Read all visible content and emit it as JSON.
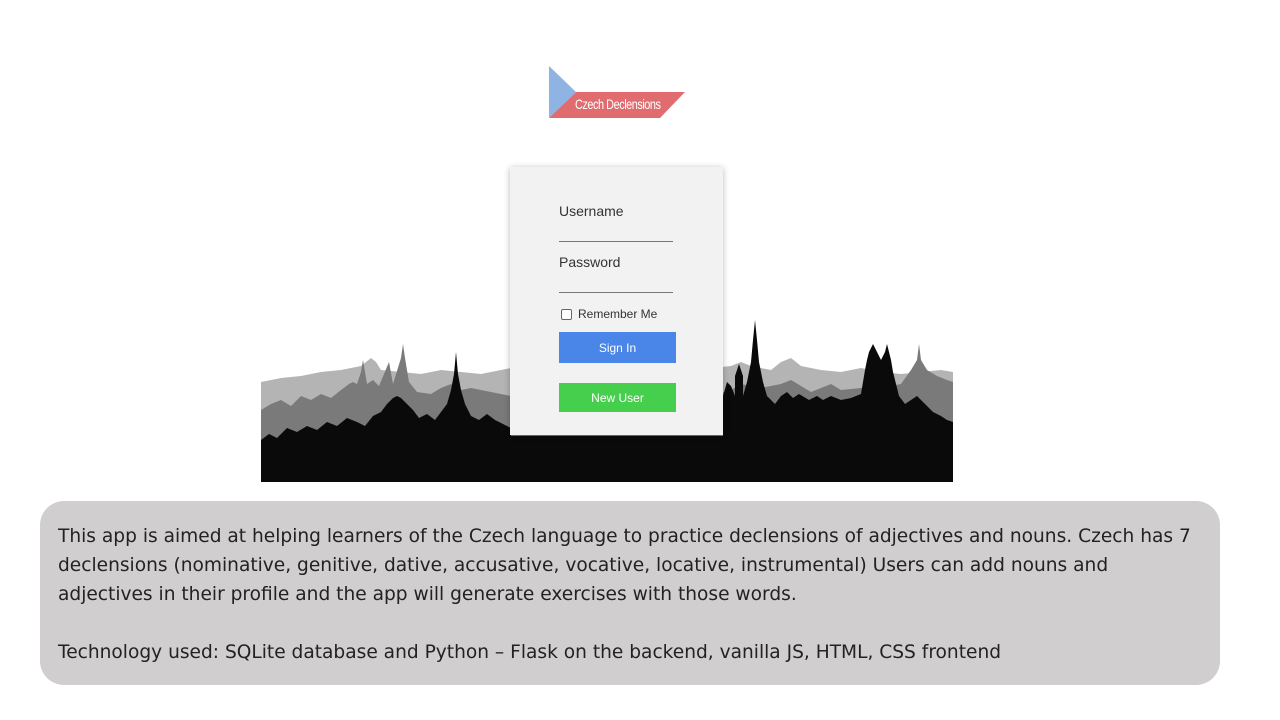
{
  "logo": {
    "text": "Czech Declensions",
    "colors": {
      "blue": "#8fb4e3",
      "red": "#e06c6f"
    }
  },
  "login": {
    "username_label": "Username",
    "username_value": "",
    "password_label": "Password",
    "password_value": "",
    "remember_label": "Remember Me",
    "remember_checked": false,
    "signin_label": "Sign In",
    "newuser_label": "New User",
    "signin_color": "#4a86e8",
    "newuser_color": "#46cf4c"
  },
  "description": {
    "paragraph1": "This app is aimed at helping learners of the Czech language to practice declensions of adjectives and nouns. Czech has 7 declensions (nominative, genitive, dative, accusative, vocative, locative, instrumental) Users can add nouns and adjectives in their profile and the app will generate exercises with those words.",
    "paragraph2": "Technology used: SQLite database and Python – Flask on the backend, vanilla JS, HTML, CSS frontend"
  }
}
